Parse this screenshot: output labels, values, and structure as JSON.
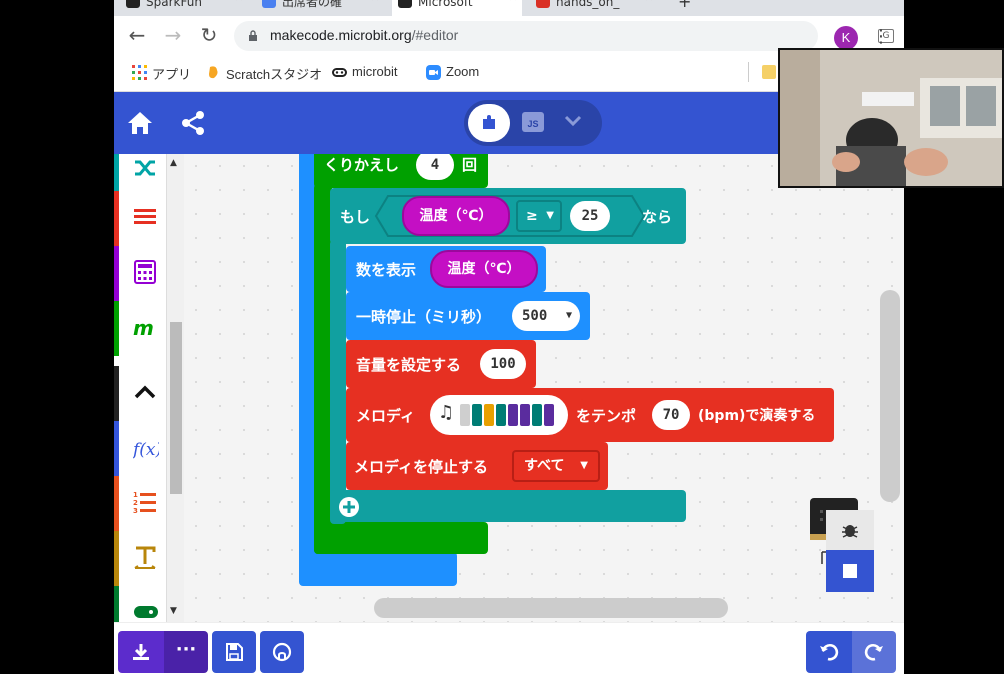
{
  "browser": {
    "tabs": [
      {
        "label": "SparkFun",
        "active": false
      },
      {
        "label": "出席者の確",
        "active": false
      },
      {
        "label": "Microsoft",
        "active": true
      },
      {
        "label": "hands_on_",
        "active": false
      }
    ],
    "new_tab_label": "+",
    "url_domain": "makecode.microbit.org",
    "url_path": "/#editor",
    "avatar_letter": "K",
    "bookmarks": [
      {
        "label": "アプリ",
        "icon": "apps-grid-icon"
      },
      {
        "label": "Scratchスタジオ",
        "icon": "scratch-icon"
      },
      {
        "label": "microbit",
        "icon": "microbit-icon"
      },
      {
        "label": "Zoom",
        "icon": "zoom-icon"
      }
    ]
  },
  "header": {
    "js_label": "JS"
  },
  "blocks": {
    "repeat": {
      "label": "くりかえし",
      "count": "4",
      "suffix": "回"
    },
    "if": {
      "label": "もし",
      "variable": "温度（℃）",
      "operator": "≥",
      "value": "25",
      "then": "なら"
    },
    "show_number": {
      "label": "数を表示",
      "variable": "温度（℃）"
    },
    "pause": {
      "label": "一時停止（ミリ秒）",
      "value": "500"
    },
    "set_volume": {
      "label": "音量を設定する",
      "value": "100"
    },
    "melody": {
      "label": "メロディ",
      "tempo_label": "をテンポ",
      "tempo": "70",
      "suffix": "(bpm)で演奏する"
    },
    "stop_melody": {
      "label": "メロディを停止する",
      "option": "すべて"
    }
  },
  "bottombar": {
    "more_label": "···"
  },
  "colors": {
    "header_blue": "#3454d1",
    "loops_green": "#00a000",
    "logic_teal": "#11a0a0",
    "basic_blue": "#1e90ff",
    "music_red": "#e63022",
    "variable_magenta": "#c40fc4"
  },
  "melody_notes": [
    "#cfcfcf",
    "#007c74",
    "#e8a000",
    "#007c74",
    "#5a2c9e",
    "#5a2c9e",
    "#007c74",
    "#5a2c9e"
  ]
}
